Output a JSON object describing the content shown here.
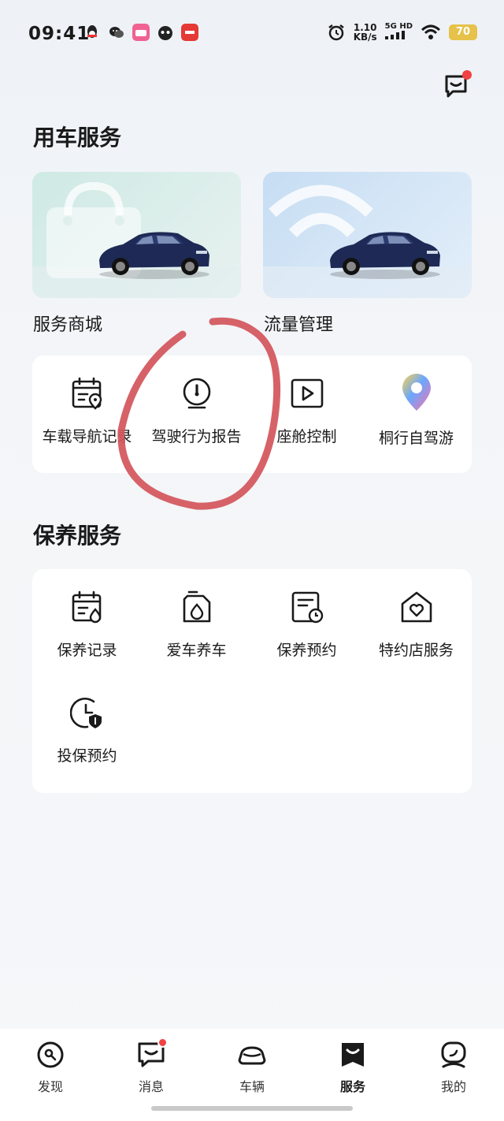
{
  "status_bar": {
    "time": "09:41",
    "speed_value": "1.10",
    "speed_unit": "KB/s",
    "network": "5G HD",
    "battery": "70"
  },
  "vehicle_services": {
    "title": "用车服务",
    "shop_label": "服务商城",
    "flow_label": "流量管理",
    "items": [
      {
        "label": "车载导航记录",
        "icon": "calendar-location-icon"
      },
      {
        "label": "驾驶行为报告",
        "icon": "speedometer-icon"
      },
      {
        "label": "座舱控制",
        "icon": "play-screen-icon"
      },
      {
        "label": "桐行自驾游",
        "icon": "map-pin-icon"
      }
    ]
  },
  "maintenance_services": {
    "title": "保养服务",
    "items": [
      {
        "label": "保养记录",
        "icon": "calendar-drop-icon"
      },
      {
        "label": "爱车养车",
        "icon": "oil-can-icon"
      },
      {
        "label": "保养预约",
        "icon": "document-clock-icon"
      },
      {
        "label": "特约店服务",
        "icon": "store-heart-icon"
      },
      {
        "label": "投保预约",
        "icon": "clock-shield-icon"
      }
    ]
  },
  "bottom_nav": [
    {
      "label": "发现",
      "icon": "discover-icon"
    },
    {
      "label": "消息",
      "icon": "message-icon"
    },
    {
      "label": "车辆",
      "icon": "car-icon"
    },
    {
      "label": "服务",
      "icon": "service-icon",
      "active": true
    },
    {
      "label": "我的",
      "icon": "profile-icon"
    }
  ],
  "colors": {
    "accent_red": "#f04242",
    "annotation_red": "#d2555b",
    "pin_gradient": [
      "#ff6fa8",
      "#6aa7ff",
      "#ffd24a"
    ]
  }
}
